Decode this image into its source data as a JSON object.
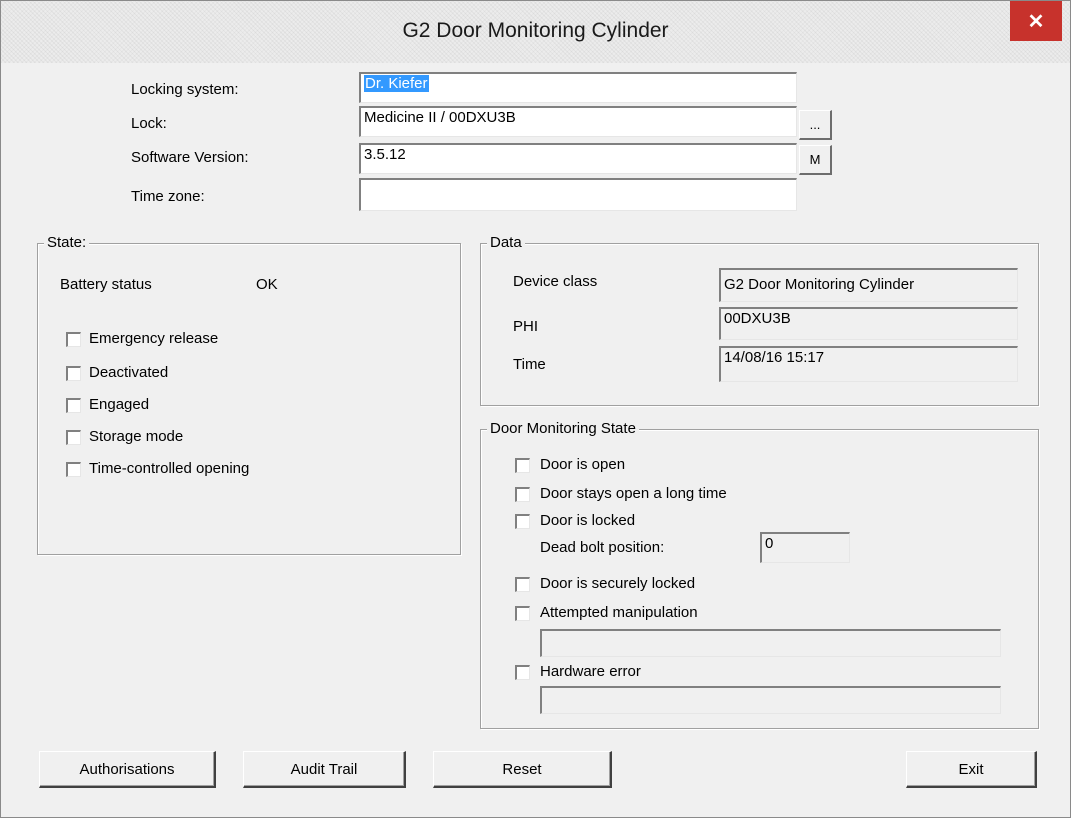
{
  "window": {
    "title": "G2 Door Monitoring Cylinder",
    "close_glyph": "✕"
  },
  "header": {
    "locking_system_label": "Locking system:",
    "locking_system_value": "Dr. Kiefer",
    "lock_label": "Lock:",
    "lock_value": "Medicine II / 00DXU3B",
    "lock_browse_label": "...",
    "software_version_label": "Software Version:",
    "software_version_value": "3.5.12",
    "software_version_button_label": "M",
    "time_zone_label": "Time zone:",
    "time_zone_value": ""
  },
  "state": {
    "title": "State:",
    "battery_status_label": "Battery status",
    "battery_status_value": "OK",
    "checkboxes": [
      {
        "label": "Emergency release",
        "checked": false
      },
      {
        "label": "Deactivated",
        "checked": false
      },
      {
        "label": "Engaged",
        "checked": false
      },
      {
        "label": "Storage mode",
        "checked": false
      },
      {
        "label": "Time-controlled opening",
        "checked": false
      }
    ]
  },
  "data": {
    "title": "Data",
    "device_class_label": "Device class",
    "device_class_value": "G2 Door Monitoring Cylinder",
    "phi_label": "PHI",
    "phi_value": "00DXU3B",
    "time_label": "Time",
    "time_value": "14/08/16 15:17"
  },
  "door_monitoring": {
    "title": "Door Monitoring State",
    "door_is_open": "Door is open",
    "door_stays_open": "Door stays open a long time",
    "door_is_locked": "Door is locked",
    "dead_bolt_label": "Dead bolt position:",
    "dead_bolt_value": "0",
    "door_securely_locked": "Door is securely locked",
    "attempted_manipulation": "Attempted manipulation",
    "attempted_manipulation_value": "",
    "hardware_error": "Hardware error",
    "hardware_error_value": ""
  },
  "buttons": {
    "authorisations": "Authorisations",
    "audit_trail": "Audit Trail",
    "reset": "Reset",
    "exit": "Exit"
  },
  "colors": {
    "close_button": "#c7322c",
    "selection": "#3399ff",
    "dialog_bg": "#f0f0f0"
  }
}
